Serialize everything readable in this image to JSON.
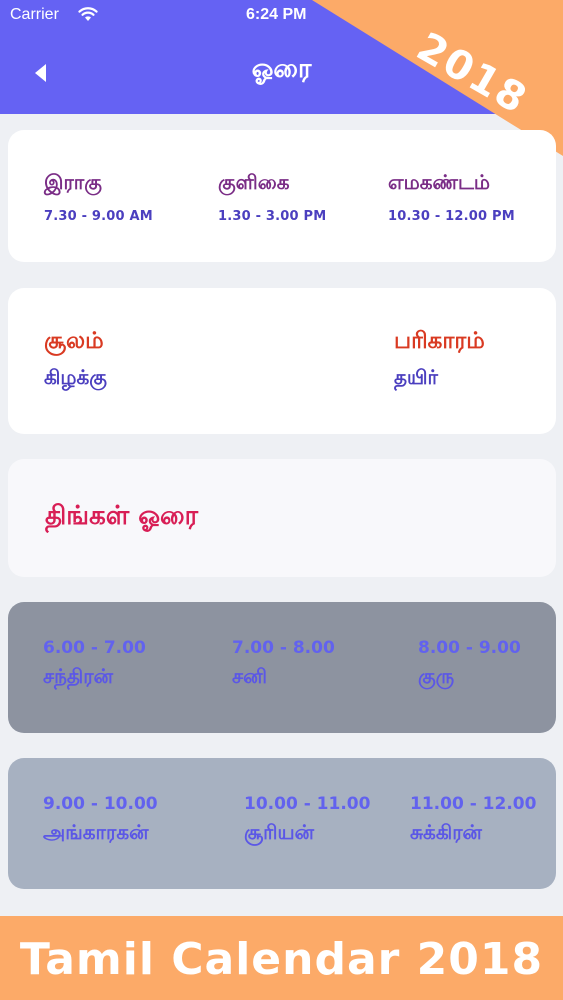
{
  "status_bar": {
    "carrier": "Carrier",
    "time": "6:24 PM"
  },
  "header": {
    "title": "ஓரை"
  },
  "ribbon": {
    "text": "2018"
  },
  "kaalam": [
    {
      "name": "இராகு",
      "time": "7.30 - 9.00 AM"
    },
    {
      "name": "குளிகை",
      "time": "1.30 - 3.00 PM"
    },
    {
      "name": "எமகண்டம்",
      "time": "10.30 - 12.00 PM"
    }
  ],
  "shoolam": {
    "label": "சூலம்",
    "value": "கிழக்கு",
    "remedy_label": "பரிகாரம்",
    "remedy_value": "தயிர்"
  },
  "day_hora": "திங்கள் ஓரை",
  "hora_rows": [
    {
      "slots": [
        {
          "time": "6.00 - 7.00",
          "planet": "சந்திரன்"
        },
        {
          "time": "7.00 - 8.00",
          "planet": "சனி"
        },
        {
          "time": "8.00 - 9.00",
          "planet": "குரு"
        }
      ]
    },
    {
      "slots": [
        {
          "time": "9.00 - 10.00",
          "planet": "அங்காரகன்"
        },
        {
          "time": "10.00 - 11.00",
          "planet": "சூரியன்"
        },
        {
          "time": "11.00 - 12.00",
          "planet": "சுக்கிரன்"
        }
      ]
    }
  ],
  "footer": {
    "banner": "Tamil Calendar 2018"
  },
  "colors": {
    "header": "#6562f3",
    "ribbon": "#fcaa68",
    "footer": "#fcaa68",
    "day_hora_text": "#d81e55",
    "shoolam_head": "#d93a22"
  },
  "icons": {
    "back": "chevron-left-icon",
    "wifi": "wifi-icon"
  }
}
